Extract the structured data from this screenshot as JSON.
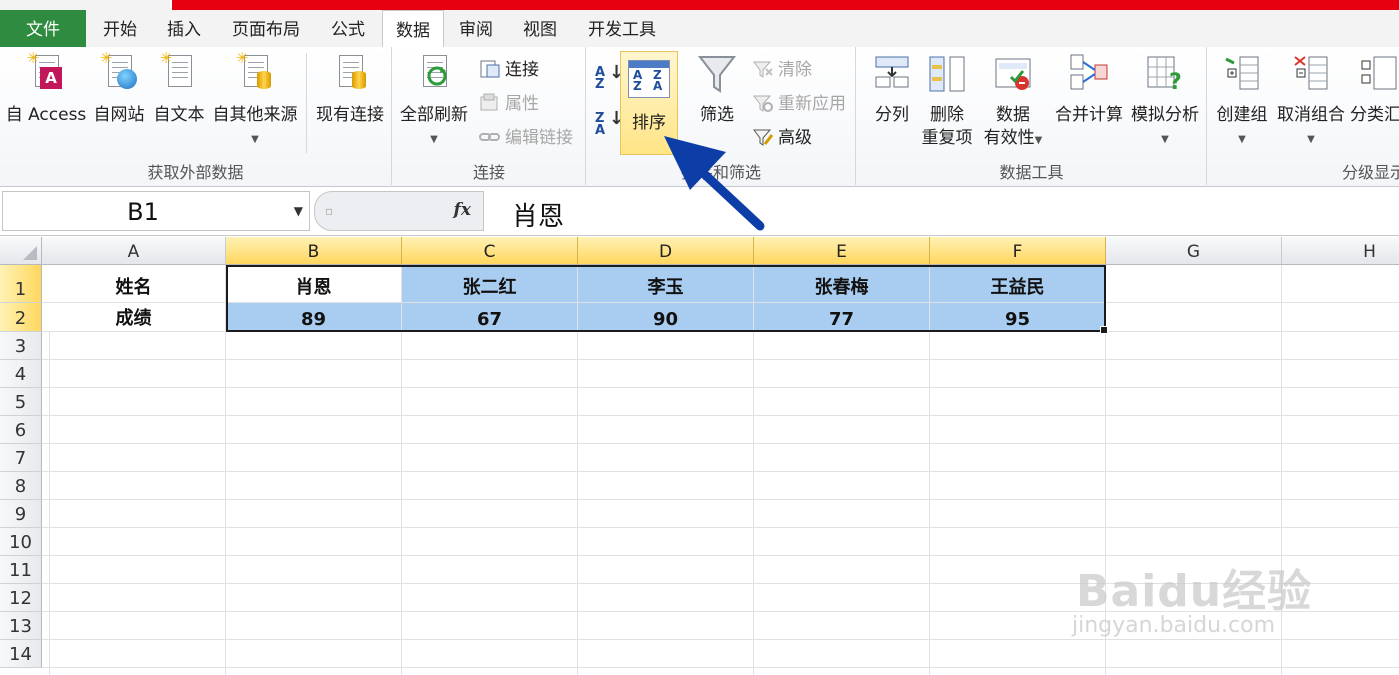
{
  "tabs": [
    "文件",
    "开始",
    "插入",
    "页面布局",
    "公式",
    "数据",
    "审阅",
    "视图",
    "开发工具"
  ],
  "active_tab": "数据",
  "ribbon": {
    "external": {
      "label": "获取外部数据",
      "access": "自 Access",
      "web": "自网站",
      "text": "自文本",
      "other": "自其他来源",
      "existing": "现有连接"
    },
    "connections": {
      "label": "连接",
      "refresh_all": "全部刷新",
      "connect": "连接",
      "properties": "属性",
      "edit_links": "编辑链接"
    },
    "sort_filter": {
      "label": "排序和筛选",
      "sort": "排序",
      "filter": "筛选",
      "clear": "清除",
      "reapply": "重新应用",
      "advanced": "高级"
    },
    "data_tools": {
      "label": "数据工具",
      "text_to_columns": "分列",
      "remove_dup_1": "删除",
      "remove_dup_2": "重复项",
      "validation_1": "数据",
      "validation_2": "有效性",
      "consolidate": "合并计算",
      "whatif": "模拟分析"
    },
    "outline": {
      "label": "分级显示",
      "group": "创建组",
      "ungroup": "取消组合",
      "subtotal": "分类汇总"
    }
  },
  "formula_bar": {
    "name_box": "B1",
    "fx": "fx",
    "value": "肖恩"
  },
  "sheet": {
    "columns": [
      "A",
      "B",
      "C",
      "D",
      "E",
      "F",
      "G",
      "H"
    ],
    "selected_columns": [
      "B",
      "C",
      "D",
      "E",
      "F"
    ],
    "rows": [
      "1",
      "2",
      "3",
      "4",
      "5",
      "6",
      "7",
      "8",
      "9",
      "10",
      "11",
      "12",
      "13",
      "14"
    ],
    "selected_rows": [
      "1",
      "2"
    ],
    "data": [
      [
        "姓名",
        "肖恩",
        "张二红",
        "李玉",
        "张春梅",
        "王益民"
      ],
      [
        "成绩",
        "89",
        "67",
        "90",
        "77",
        "95"
      ]
    ]
  },
  "watermark": {
    "brand": "Baidu经验",
    "url": "jingyan.baidu.com"
  },
  "colors": {
    "file_tab": "#2e8b3f",
    "title_bar": "#e6000f",
    "selection_fill": "#a9cdf0",
    "header_highlight": "#ffd75e",
    "arrow": "#0d3ea8"
  }
}
